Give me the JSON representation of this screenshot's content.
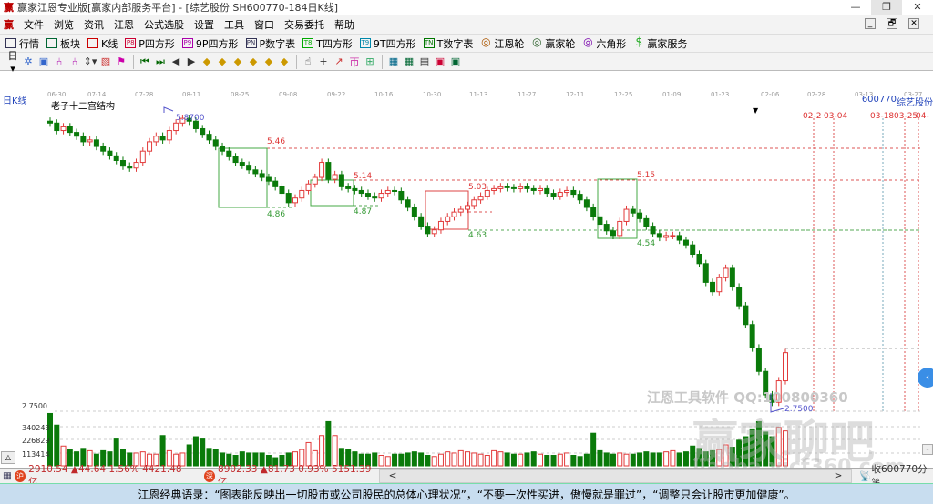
{
  "window": {
    "title": "赢家江恩专业版[赢家内部服务平台] - [综艺股份  SH600770-184日K线]",
    "minimize": "—",
    "restore": "❐",
    "close": "✕"
  },
  "menu": [
    "文件",
    "浏览",
    "资讯",
    "江恩",
    "公式选股",
    "设置",
    "工具",
    "窗口",
    "交易委托",
    "帮助"
  ],
  "mdi": [
    "_",
    "🗗",
    "✕"
  ],
  "toolbar": [
    {
      "label": "行情",
      "icon": "grid-icon",
      "color": "#335"
    },
    {
      "label": "板块",
      "icon": "blocks-icon",
      "color": "#063"
    },
    {
      "label": "K线",
      "icon": "candle-icon",
      "color": "#c00"
    },
    {
      "label": "P四方形",
      "icon": "P8",
      "color": "#c03"
    },
    {
      "label": "9P四方形",
      "icon": "P9",
      "color": "#a0a"
    },
    {
      "label": "P数字表",
      "icon": "PN",
      "color": "#335"
    },
    {
      "label": "T四方形",
      "icon": "T8",
      "color": "#0a0"
    },
    {
      "label": "9T四方形",
      "icon": "T9",
      "color": "#08a"
    },
    {
      "label": "T数字表",
      "icon": "TN",
      "color": "#070"
    },
    {
      "label": "江恩轮",
      "icon": "◎",
      "color": "#a50"
    },
    {
      "label": "赢家轮",
      "icon": "◎",
      "color": "#363"
    },
    {
      "label": "六角形",
      "icon": "◎",
      "color": "#70a"
    },
    {
      "label": "赢家服务",
      "icon": "$",
      "color": "#2a2"
    }
  ],
  "toolbar2": [
    "日▾",
    "✲",
    "▣",
    "⑃",
    "⑃",
    "⇕▾",
    "▧",
    "⚑",
    "|",
    "⏮",
    "⏭",
    "◀",
    "▶",
    "◆",
    "◆",
    "◆",
    "◆",
    "◆",
    "◆",
    "|",
    "☝",
    "+",
    "↗",
    "帀",
    "⊞",
    "|",
    "▦",
    "▦",
    "▤",
    "▣",
    "▣"
  ],
  "chart": {
    "period_label": "日K线",
    "indicator_name": "老子十二宫结构",
    "stock_code": "600770",
    "stock_name": "综艺股份",
    "dates_top": [
      "06-30",
      "07-14",
      "07-28",
      "08-11",
      "08-25",
      "09-08",
      "09-22",
      "10-16",
      "10-30",
      "11-13",
      "11-27",
      "12-11",
      "12-25",
      "01-09",
      "01-23",
      "02-06",
      "02-28",
      "03-13",
      "03-27"
    ],
    "future_dates": [
      "02-2",
      "03-04",
      "03-18",
      "03-25",
      "04-"
    ],
    "high_label": "5.8700",
    "low_label": "2.7500",
    "levels": [
      {
        "text": "5.46",
        "color": "#d33"
      },
      {
        "text": "4.86",
        "color": "#393"
      },
      {
        "text": "5.14",
        "color": "#d33"
      },
      {
        "text": "4.87",
        "color": "#393"
      },
      {
        "text": "5.03",
        "color": "#d33"
      },
      {
        "text": "4.63",
        "color": "#393"
      },
      {
        "text": "5.15",
        "color": "#d33"
      },
      {
        "text": "4.54",
        "color": "#393"
      }
    ],
    "volume_axis": [
      "2.7500",
      "340243",
      "226829",
      "113414"
    ],
    "watermark_1": "江恩工具软件  QQ:100800360",
    "watermark_2": "赢家聊吧",
    "watermark_3": "liaoba.yjcf360.com",
    "up_color": "#e23b3b",
    "down_color": "#0a7a0a"
  },
  "chart_data": {
    "type": "candlestick",
    "ylim": [
      2.75,
      5.87
    ],
    "closes": [
      5.8,
      5.72,
      5.76,
      5.7,
      5.66,
      5.6,
      5.62,
      5.55,
      5.5,
      5.45,
      5.4,
      5.34,
      5.32,
      5.38,
      5.5,
      5.6,
      5.66,
      5.62,
      5.72,
      5.8,
      5.85,
      5.82,
      5.74,
      5.68,
      5.62,
      5.55,
      5.5,
      5.44,
      5.38,
      5.35,
      5.3,
      5.26,
      5.22,
      5.18,
      5.12,
      5.05,
      4.95,
      5.0,
      5.08,
      5.15,
      5.22,
      5.38,
      5.2,
      5.25,
      5.12,
      5.1,
      5.08,
      5.05,
      5.02,
      5.0,
      5.05,
      5.08,
      5.07,
      4.98,
      4.9,
      4.8,
      4.7,
      4.62,
      4.66,
      4.75,
      4.8,
      4.85,
      4.88,
      4.92,
      4.98,
      5.02,
      5.08,
      5.1,
      5.12,
      5.11,
      5.1,
      5.12,
      5.1,
      5.08,
      5.1,
      5.05,
      5.02,
      5.06,
      5.08,
      5.04,
      4.98,
      4.9,
      4.8,
      4.72,
      4.65,
      4.6,
      4.75,
      4.88,
      4.84,
      4.78,
      4.7,
      4.62,
      4.58,
      4.6,
      4.6,
      4.55,
      4.5,
      4.4,
      4.3,
      4.1,
      4.0,
      4.15,
      4.25,
      4.05,
      3.85,
      3.65,
      3.4,
      3.15,
      2.9,
      2.82,
      3.05,
      3.35
    ],
    "volumes": [
      450000,
      350000,
      170000,
      140000,
      120000,
      150000,
      130000,
      100000,
      130000,
      120000,
      230000,
      140000,
      110000,
      110000,
      120000,
      100000,
      100000,
      260000,
      130000,
      100000,
      110000,
      180000,
      250000,
      230000,
      150000,
      140000,
      110000,
      100000,
      90000,
      120000,
      110000,
      110000,
      110000,
      90000,
      70000,
      90000,
      110000,
      120000,
      140000,
      200000,
      130000,
      260000,
      380000,
      260000,
      150000,
      140000,
      120000,
      100000,
      100000,
      110000,
      90000,
      80000,
      100000,
      100000,
      110000,
      120000,
      110000,
      90000,
      80000,
      100000,
      120000,
      110000,
      130000,
      120000,
      110000,
      100000,
      90000,
      130000,
      120000,
      110000,
      100000,
      100000,
      110000,
      120000,
      100000,
      90000,
      90000,
      100000,
      110000,
      90000,
      80000,
      100000,
      280000,
      130000,
      110000,
      100000,
      110000,
      100000,
      100000,
      110000,
      120000,
      110000,
      110000,
      120000,
      130000,
      110000,
      120000,
      170000,
      150000,
      120000,
      130000,
      140000,
      180000,
      160000,
      220000,
      250000,
      310000,
      380000,
      290000,
      250000,
      330000,
      300000
    ]
  },
  "status": {
    "sh_badge": "沪",
    "sh": "2910.54 ▲44.64 1.56% 4421.48亿",
    "sz_badge": "深",
    "sz": "8902.33 ▲81.73 0.93% 5151.39亿",
    "scroll_left": "<",
    "scroll_right": ">",
    "receive": "收600770分笔"
  },
  "ticker": "江恩经典语录：“图表能反映出一切股市或公司股民的总体心理状况”，“不要一次性买进，傲慢就是罪过”，“调整只会让股市更加健康”。"
}
